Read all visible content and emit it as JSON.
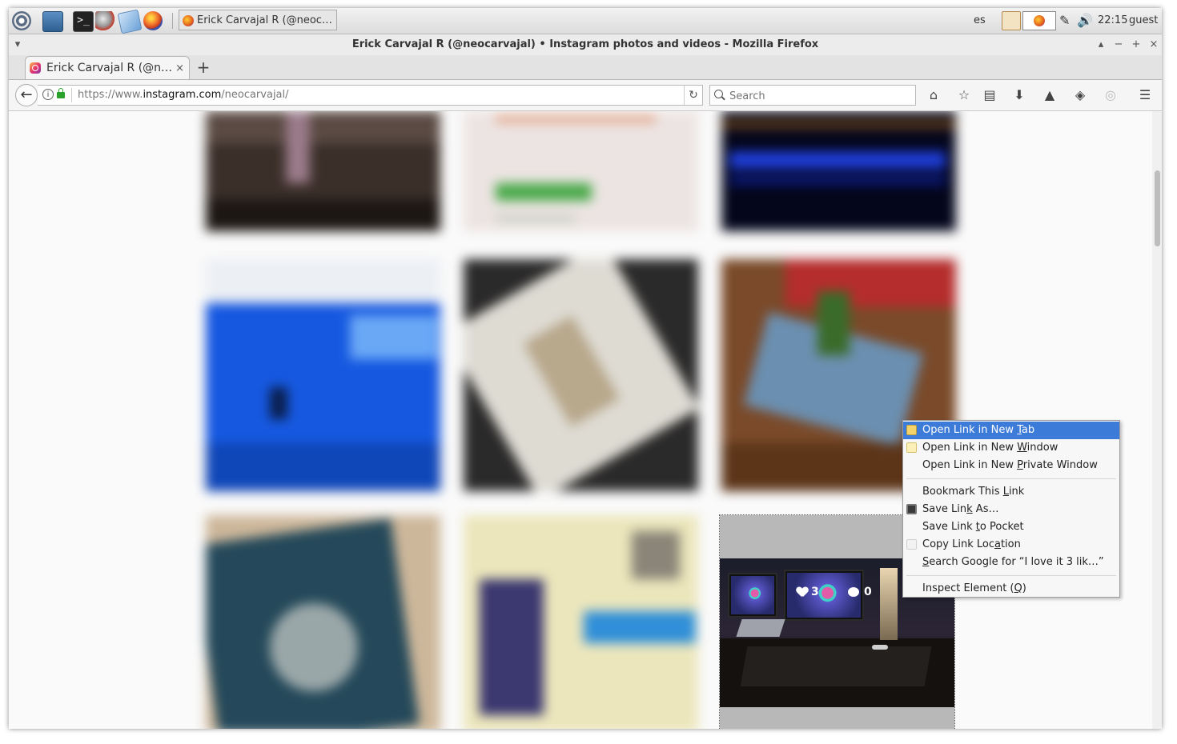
{
  "taskbar": {
    "task_title": "Erick Carvajal R (@neoc…",
    "keyboard_layout": "es",
    "clock": "22:15",
    "user": "guest"
  },
  "window": {
    "title": "Erick Carvajal R (@neocarvajal) • Instagram photos and videos - Mozilla Firefox",
    "controls": [
      "▴",
      "−",
      "+",
      "×"
    ]
  },
  "tabs": [
    {
      "title": "Erick Carvajal R (@n…",
      "close": "×"
    }
  ],
  "newtab_label": "+",
  "navbar": {
    "url_prefix": "https://www.",
    "url_domain": "instagram.com",
    "url_path": "/neocarvajal/",
    "search_placeholder": "Search"
  },
  "post": {
    "likes": "3",
    "comments": "0"
  },
  "context_menu": {
    "items": [
      {
        "pre": "Open Link in New ",
        "key": "T",
        "post": "ab",
        "icon": "new-tab-icon"
      },
      {
        "pre": "Open Link in New ",
        "key": "W",
        "post": "indow",
        "icon": "new-window-icon"
      },
      {
        "pre": "Open Link in New ",
        "key": "P",
        "post": "rivate Window",
        "icon": ""
      },
      {
        "pre": "Bookmark This ",
        "key": "L",
        "post": "ink",
        "icon": ""
      },
      {
        "pre": "Save Lin",
        "key": "k",
        "post": " As…",
        "icon": "save-icon"
      },
      {
        "pre": "Save Link ",
        "key": "t",
        "post": "o Pocket",
        "icon": ""
      },
      {
        "pre": "Copy Link Loc",
        "key": "a",
        "post": "tion",
        "icon": "copy-icon"
      },
      {
        "pre": "",
        "key": "S",
        "post": "earch Google for “I love it 3 lik…”",
        "icon": ""
      },
      {
        "pre": "Inspect Element (",
        "key": "Q",
        "post": ")",
        "icon": ""
      }
    ]
  },
  "colors": {
    "menu_highlight": "#3d7bd9",
    "lock_green": "#2aa12a"
  }
}
